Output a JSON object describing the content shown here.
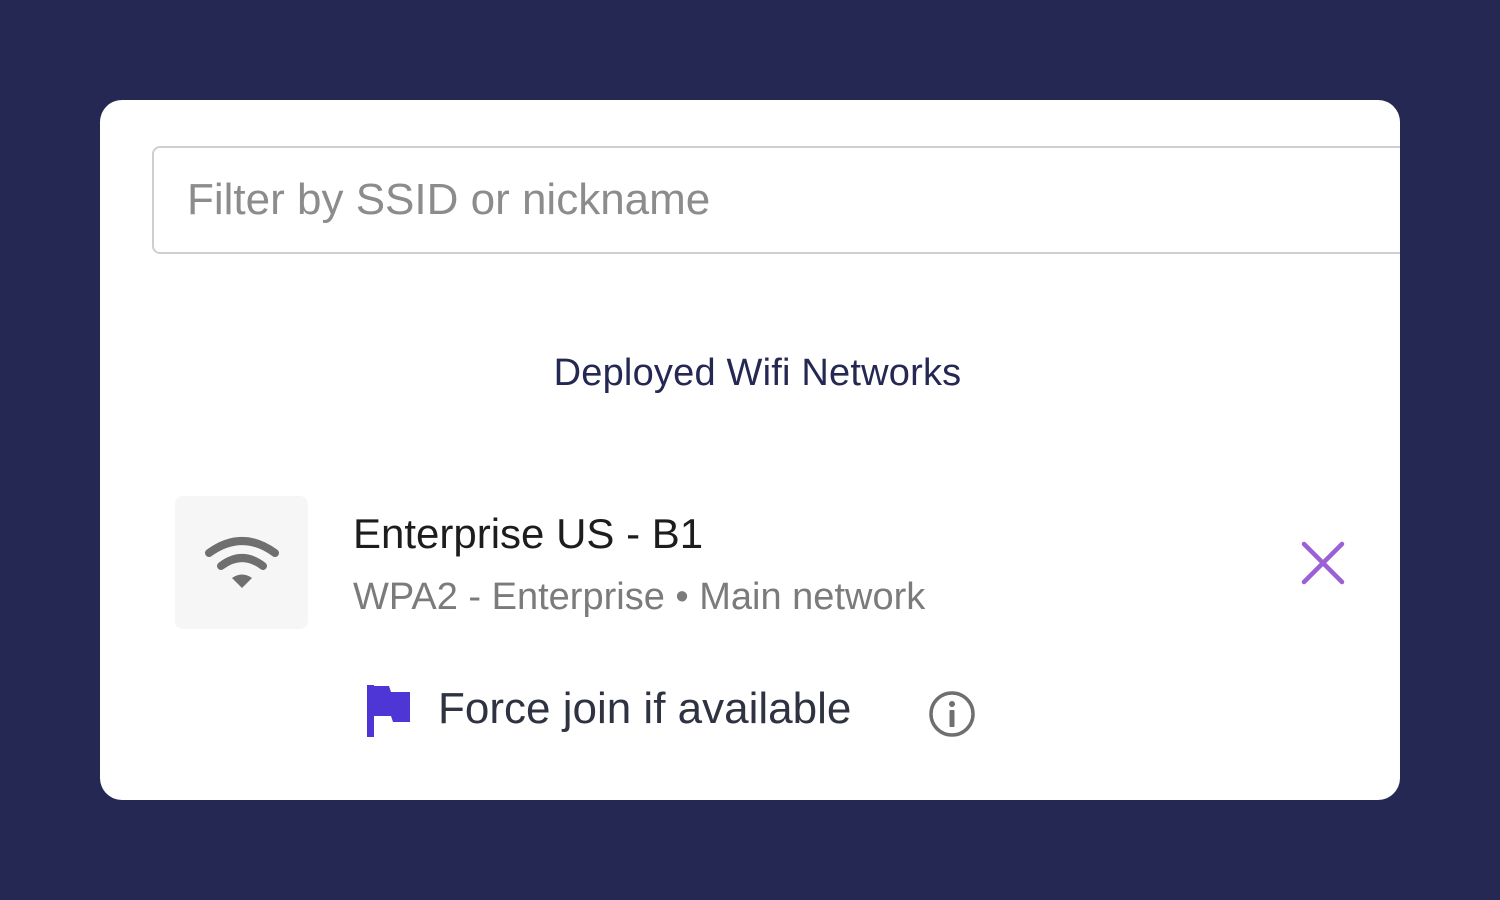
{
  "filter": {
    "placeholder": "Filter by SSID or nickname",
    "value": ""
  },
  "section": {
    "title": "Deployed Wifi Networks"
  },
  "network": {
    "icon": "wifi-icon",
    "name": "Enterprise US - B1",
    "meta": "WPA2 - Enterprise • Main network",
    "remove_icon": "close-icon",
    "force_join_label": "Force join if available",
    "flag_icon": "flag-icon",
    "info_icon": "info-icon"
  },
  "colors": {
    "background": "#252852",
    "title": "#252852",
    "close": "#9b5fd6",
    "flag": "#4e36d6",
    "wifi_icon": "#6f6f6f"
  }
}
